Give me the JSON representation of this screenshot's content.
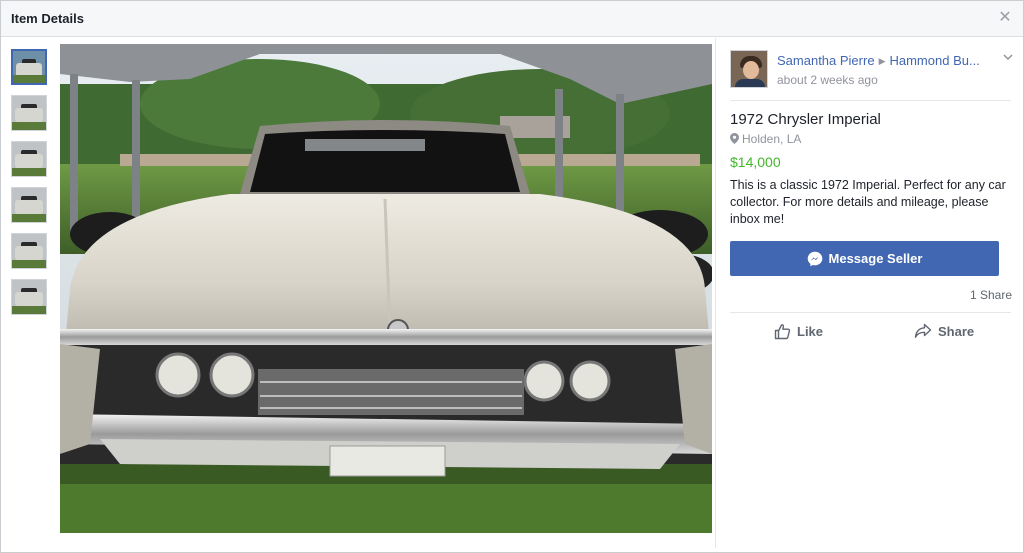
{
  "modal": {
    "title": "Item Details",
    "close_icon": "close-icon"
  },
  "thumbnails": [
    {
      "name": "photo-1",
      "active": true
    },
    {
      "name": "photo-2",
      "active": false
    },
    {
      "name": "photo-3",
      "active": false
    },
    {
      "name": "photo-4",
      "active": false
    },
    {
      "name": "photo-5",
      "active": false
    },
    {
      "name": "photo-6",
      "active": false
    }
  ],
  "seller": {
    "name": "Samantha Pierre",
    "group": "Hammond Bu...",
    "posted": "about 2 weeks ago"
  },
  "item": {
    "title": "1972 Chrysler Imperial",
    "location": "Holden, LA",
    "price": "$14,000",
    "description": "This is a classic 1972 Imperial. Perfect for any car collector. For more details and mileage, please inbox me!"
  },
  "actions": {
    "message_label": "Message Seller",
    "share_count": "1 Share",
    "like_label": "Like",
    "share_label": "Share"
  },
  "colors": {
    "accent": "#4267b2",
    "price": "#42b72a",
    "muted": "#90949c"
  }
}
